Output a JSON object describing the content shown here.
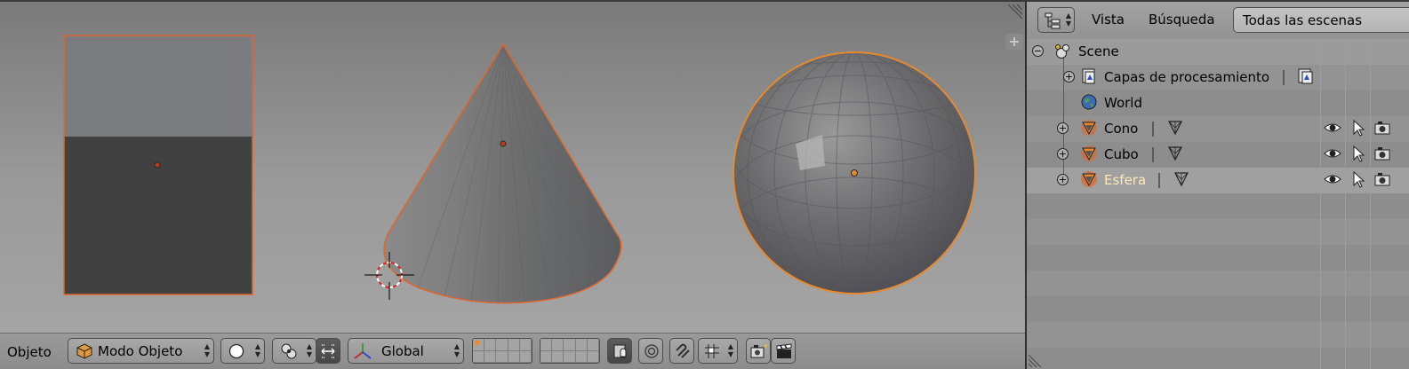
{
  "viewport": {
    "objects": [
      "cube",
      "cone",
      "sphere"
    ]
  },
  "view3d_header": {
    "menu_label": "Objeto",
    "mode_label": "Modo Objeto",
    "orientation_label": "Global"
  },
  "outliner": {
    "header": {
      "view_menu": "Vista",
      "search_menu": "Búsqueda",
      "display_mode": "Todas las escenas"
    },
    "tree": {
      "scene_label": "Scene",
      "render_layers_label": "Capas de procesamiento",
      "world_label": "World",
      "objects": [
        {
          "label": "Cono",
          "active": false
        },
        {
          "label": "Cubo",
          "active": false
        },
        {
          "label": "Esfera",
          "active": true
        }
      ]
    }
  },
  "colors": {
    "selection_outline": "#e2652a",
    "active_text": "#ffe8b4",
    "object_icon": "#e8892e"
  }
}
